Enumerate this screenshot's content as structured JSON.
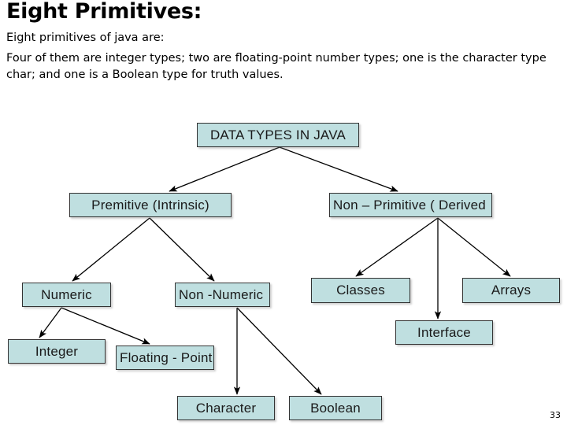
{
  "slide": {
    "title": "Eight Primitives:",
    "paragraphs": [
      "Eight primitives of java are:",
      "Four of them are integer types; two are floating-point number types; one is the character type char; and one is a Boolean type for truth values."
    ],
    "page_number": "33"
  },
  "diagram": {
    "type": "tree",
    "box_fill_color": "#bfdfe0",
    "box_border_color": "#333333",
    "arrow_color": "#000000",
    "nodes": {
      "root": "DATA TYPES IN JAVA",
      "primitive": "Premitive (Intrinsic)",
      "non_primitive": "Non – Primitive ( Derived",
      "numeric": "Numeric",
      "non_numeric": "Non -Numeric",
      "classes": "Classes",
      "arrays": "Arrays",
      "interface": "Interface",
      "integer": "Integer",
      "floating_point": "Floating - Point",
      "character": "Character",
      "boolean": "Boolean"
    },
    "edges": [
      {
        "from": "root",
        "to": "primitive"
      },
      {
        "from": "root",
        "to": "non_primitive"
      },
      {
        "from": "primitive",
        "to": "numeric"
      },
      {
        "from": "primitive",
        "to": "non_numeric"
      },
      {
        "from": "non_primitive",
        "to": "classes"
      },
      {
        "from": "non_primitive",
        "to": "interface"
      },
      {
        "from": "non_primitive",
        "to": "arrays"
      },
      {
        "from": "numeric",
        "to": "integer"
      },
      {
        "from": "numeric",
        "to": "floating_point"
      },
      {
        "from": "non_numeric",
        "to": "character"
      },
      {
        "from": "non_numeric",
        "to": "boolean"
      }
    ]
  }
}
